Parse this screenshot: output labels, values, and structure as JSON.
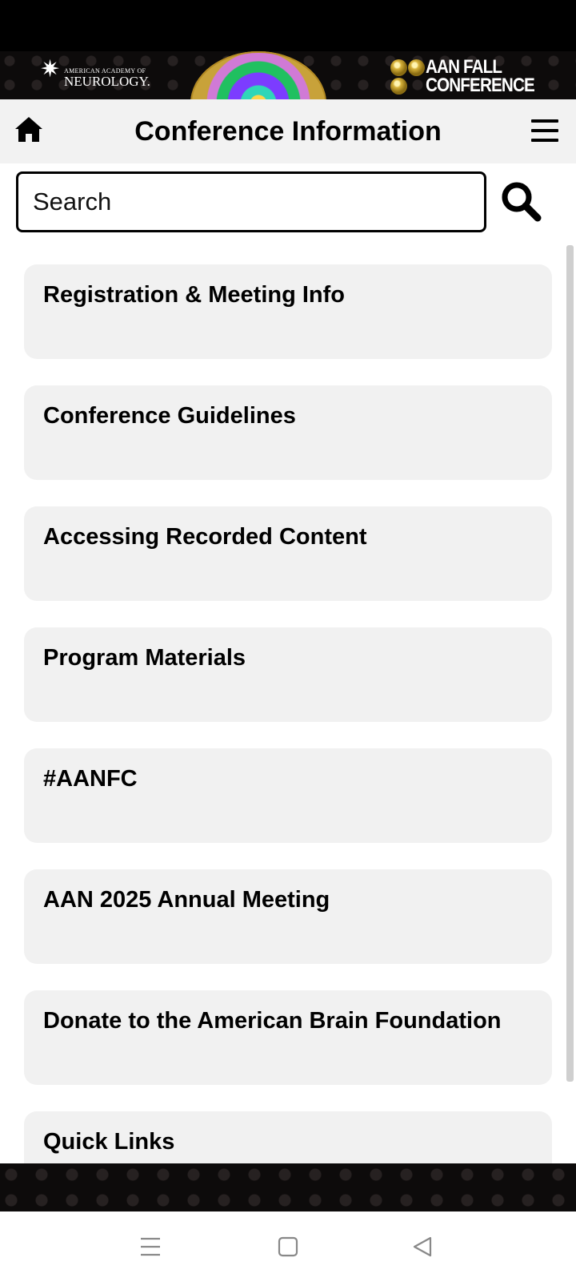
{
  "banner": {
    "org_line1": "AMERICAN ACADEMY OF",
    "org_line2": "NEUROLOGY.",
    "conf_line1": "AAN FALL",
    "conf_line2": "CONFERENCE"
  },
  "header": {
    "title": "Conference Information",
    "home_icon": "home-icon",
    "menu_icon": "hamburger-menu-icon"
  },
  "search": {
    "placeholder": "Search",
    "value": "",
    "icon": "search-icon"
  },
  "items": [
    {
      "label": "Registration & Meeting Info"
    },
    {
      "label": "Conference Guidelines"
    },
    {
      "label": "Accessing Recorded Content"
    },
    {
      "label": "Program Materials"
    },
    {
      "label": "#AANFC"
    },
    {
      "label": "AAN 2025 Annual Meeting"
    },
    {
      "label": "Donate to the American Brain Foundation"
    },
    {
      "label": "Quick Links"
    }
  ],
  "nav": {
    "recents_icon": "recents-icon",
    "home_icon": "system-home-icon",
    "back_icon": "back-icon"
  },
  "colors": {
    "header_bg": "#f2f2f2",
    "item_bg": "#f1f1f1",
    "banner_bg": "#0d0b0b"
  }
}
